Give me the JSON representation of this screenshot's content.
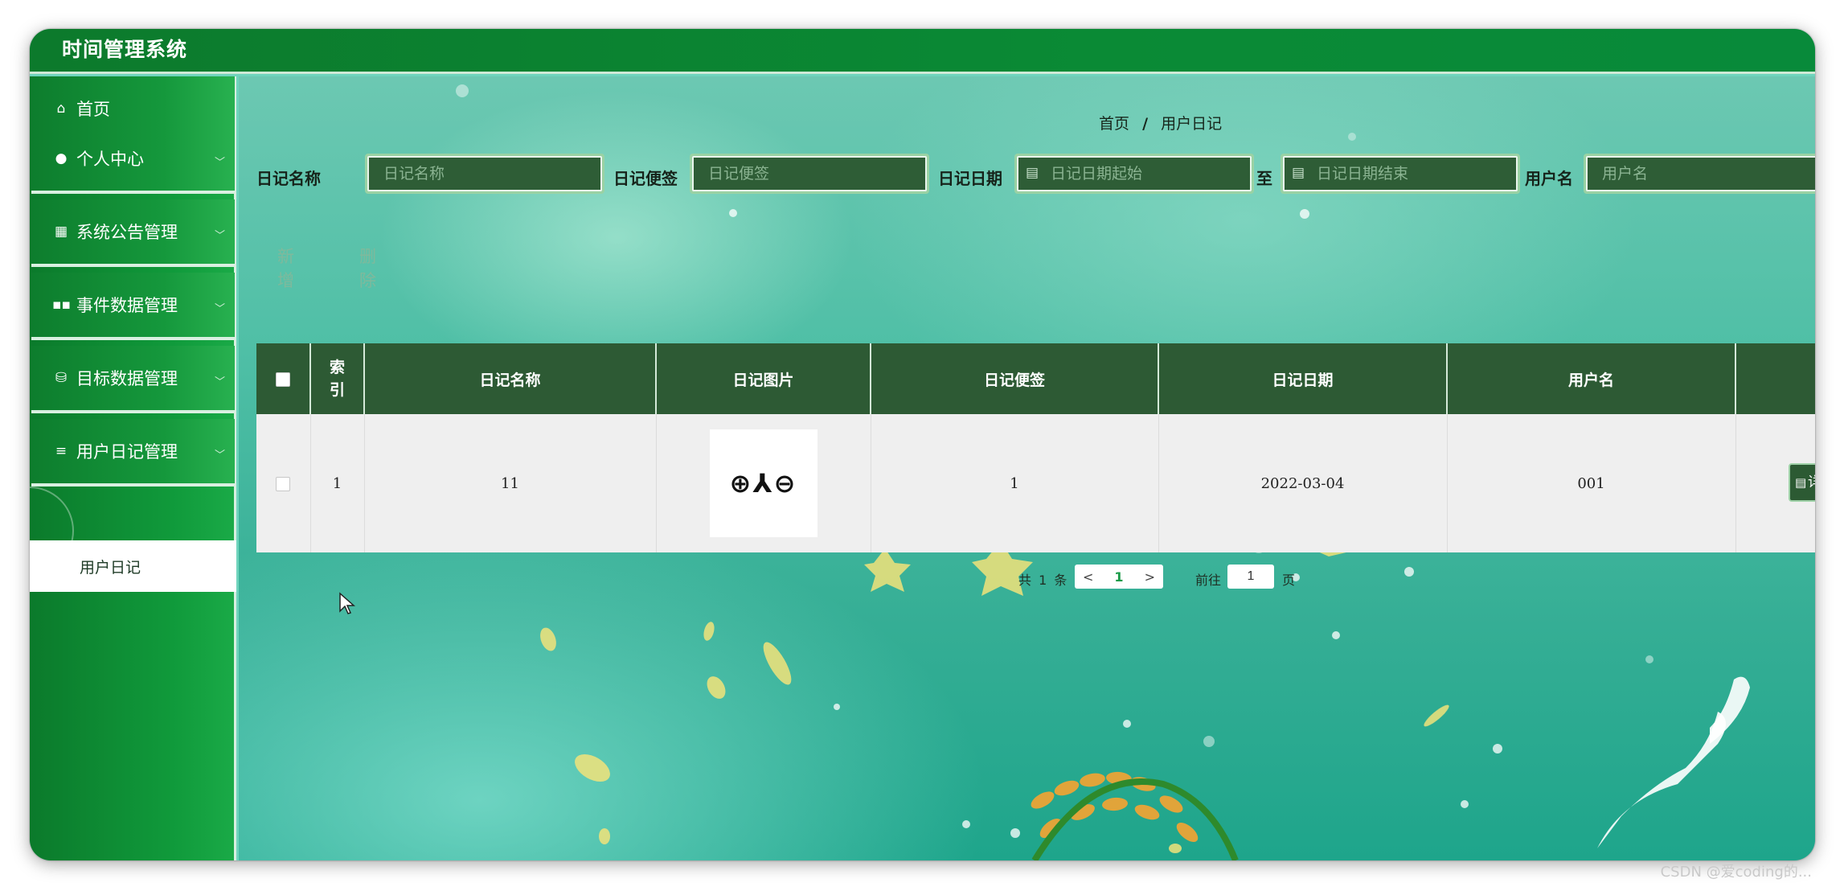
{
  "app_title": "时间管理系统",
  "sidebar": {
    "items": [
      {
        "label": "首页",
        "icon": "home-icon",
        "glyph": "⌂"
      },
      {
        "label": "个人中心",
        "icon": "user-icon",
        "glyph": "●"
      },
      {
        "label": "系统公告管理",
        "icon": "grid-icon",
        "glyph": "▦"
      },
      {
        "label": "事件数据管理",
        "icon": "apps-icon",
        "glyph": "▪▪"
      },
      {
        "label": "目标数据管理",
        "icon": "database-icon",
        "glyph": "⛁"
      },
      {
        "label": "用户日记管理",
        "icon": "list-icon",
        "glyph": "≡"
      }
    ],
    "active_submenu": "用户日记",
    "chevron": "﹀"
  },
  "breadcrumb": {
    "home": "首页",
    "separator": "/",
    "current": "用户日记"
  },
  "search": {
    "name_label": "日记名称",
    "name_placeholder": "日记名称",
    "note_label": "日记便签",
    "note_placeholder": "日记便签",
    "date_label": "日记日期",
    "date_start_placeholder": "日记日期起始",
    "date_to": "至",
    "date_end_placeholder": "日记日期结束",
    "user_label": "用户名",
    "user_placeholder": "用户名",
    "calendar_icon": "▤"
  },
  "actions": {
    "add": "新增",
    "delete": "删除"
  },
  "table": {
    "headers": [
      "索引",
      "日记名称",
      "日记图片",
      "日记便签",
      "日记日期",
      "用户名"
    ],
    "rows": [
      {
        "index": "1",
        "name": "11",
        "image_text": "⊕⅄⊖",
        "note": "1",
        "date": "2022-03-04",
        "user": "001"
      }
    ],
    "detail_label": "详情"
  },
  "pagination": {
    "total_prefix": "共",
    "total": "1",
    "total_suffix": "条",
    "prev": "<",
    "page": "1",
    "next": ">",
    "goto_prefix": "前往",
    "goto_value": "1",
    "goto_suffix": "页"
  },
  "watermark": "CSDN @爱coding的..."
}
